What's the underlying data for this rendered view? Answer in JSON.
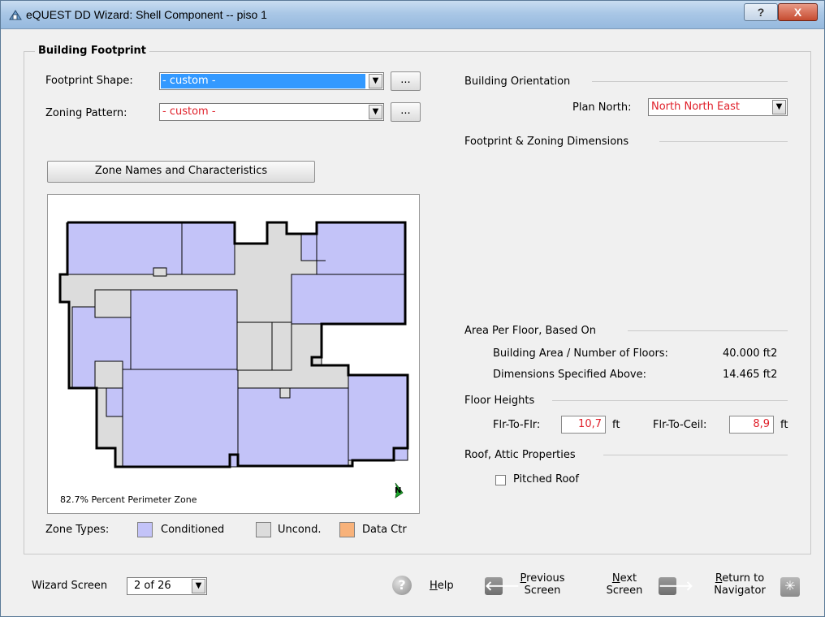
{
  "window": {
    "title": "eQUEST DD Wizard: Shell Component  --  piso 1",
    "help_btn": "?",
    "close_btn": "X"
  },
  "group": {
    "title": "Building Footprint"
  },
  "footprint_shape": {
    "label": "Footprint Shape:",
    "value": "- custom -",
    "more": "..."
  },
  "zoning_pattern": {
    "label": "Zoning Pattern:",
    "value": "- custom -",
    "more": "..."
  },
  "zone_names_button": "Zone Names and Characteristics",
  "plot": {
    "perimeter_note": "82.7% Percent Perimeter Zone",
    "north_marker": "N"
  },
  "zone_types": {
    "label": "Zone Types:",
    "items": [
      {
        "label": "Conditioned",
        "color": "#c3c3f8"
      },
      {
        "label": "Uncond.",
        "color": "#dcdcdc"
      },
      {
        "label": "Data Ctr",
        "color": "#f8b27a"
      }
    ]
  },
  "orientation": {
    "section": "Building Orientation",
    "plan_north_label": "Plan North:",
    "plan_north_value": "North North East"
  },
  "dimensions_section": "Footprint & Zoning Dimensions",
  "area": {
    "section": "Area Per Floor, Based On",
    "rows": [
      {
        "label": "Building Area / Number of Floors:",
        "value": "40.000 ft2"
      },
      {
        "label": "Dimensions Specified Above:",
        "value": "14.465 ft2"
      }
    ]
  },
  "heights": {
    "section": "Floor Heights",
    "flr_to_flr_label": "Flr-To-Flr:",
    "flr_to_flr_value": "10,7",
    "flr_to_ceil_label": "Flr-To-Ceil:",
    "flr_to_ceil_value": "8,9",
    "unit": "ft"
  },
  "roof": {
    "section": "Roof, Attic Properties",
    "pitched_label": "Pitched Roof",
    "pitched_checked": false
  },
  "footer": {
    "wizard_screen_label": "Wizard Screen",
    "wizard_screen_value": "2 of 26",
    "help_label": "Help",
    "previous_line1": "Previous",
    "previous_line2": "Screen",
    "next_line1": "Next",
    "next_line2": "Screen",
    "return_line1": "Return to",
    "return_line2": "Navigator"
  },
  "colors": {
    "conditioned": "#c3c3f8",
    "unconditioned": "#dcdcdc",
    "data_center": "#f8b27a",
    "red_value": "#e0202a",
    "selection": "#3399ff"
  }
}
